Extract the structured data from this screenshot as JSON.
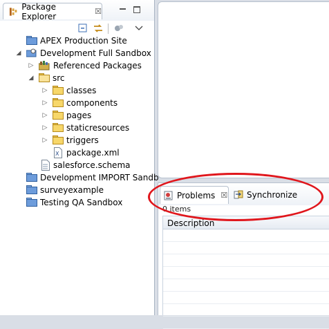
{
  "package_explorer": {
    "tab_title": "Package Explorer",
    "close_glyph": "☒",
    "tree": [
      {
        "label": "APEX Production Site",
        "icon": "project-icon"
      },
      {
        "label": "Development Full Sandbox",
        "icon": "project-icon",
        "expanded": true
      },
      {
        "label": "Referenced Packages",
        "icon": "library-icon"
      },
      {
        "label": "src",
        "icon": "folder-open-icon",
        "expanded": true
      },
      {
        "label": "classes",
        "icon": "folder-icon"
      },
      {
        "label": "components",
        "icon": "folder-icon"
      },
      {
        "label": "pages",
        "icon": "folder-icon"
      },
      {
        "label": "staticresources",
        "icon": "folder-icon"
      },
      {
        "label": "triggers",
        "icon": "folder-icon"
      },
      {
        "label": "package.xml",
        "icon": "xml-file-icon"
      },
      {
        "label": "salesforce.schema",
        "icon": "schema-file-icon"
      },
      {
        "label": "Development IMPORT Sandb",
        "icon": "project-icon"
      },
      {
        "label": "surveyexample",
        "icon": "project-icon"
      },
      {
        "label": "Testing QA Sandbox",
        "icon": "project-icon"
      }
    ]
  },
  "problems_view": {
    "tabs": [
      {
        "label": "Problems",
        "icon": "problems-icon",
        "active": true
      },
      {
        "label": "Synchronize",
        "icon": "synchronize-icon",
        "active": false
      }
    ],
    "close_glyph": "☒",
    "items_count": "0 items",
    "columns": [
      "Description"
    ]
  },
  "colors": {
    "highlight": "#e0161c",
    "project": "#6d9cdb",
    "folder": "#f7d76a"
  }
}
